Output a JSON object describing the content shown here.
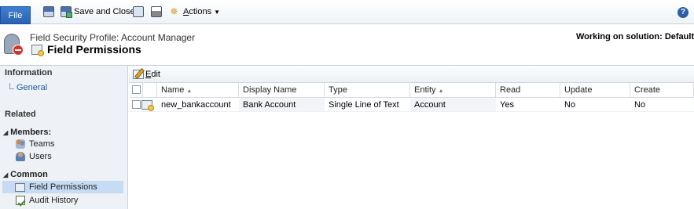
{
  "ribbon": {
    "file_label": "File",
    "save_close_label": "Save and Close",
    "actions_label": "Actions",
    "actions_underline": "A",
    "actions_rest": "ctions"
  },
  "header": {
    "subtitle": "Field Security Profile: Account Manager",
    "title": "Field Permissions",
    "working_on": "Working on solution: Default So"
  },
  "leftnav": {
    "information_label": "Information",
    "general_label": "General",
    "related_label": "Related",
    "members_label": "Members:",
    "teams_label": "Teams",
    "users_label": "Users",
    "common_label": "Common",
    "field_permissions_label": "Field Permissions",
    "audit_history_label": "Audit History"
  },
  "toolbar": {
    "edit_label": "Edit",
    "edit_underline": "E",
    "edit_rest": "dit"
  },
  "grid": {
    "columns": [
      "Name",
      "Display Name",
      "Type",
      "Entity",
      "Read",
      "Update",
      "Create"
    ],
    "rows": [
      {
        "name": "new_bankaccount",
        "display_name": "Bank Account",
        "type": "Single Line of Text",
        "entity": "Account",
        "read": "Yes",
        "update": "No",
        "create": "No"
      }
    ]
  },
  "colors": {
    "accent": "#2a62b3",
    "selected_nav": "#c6dcf4",
    "link": "#1b5aa7"
  }
}
